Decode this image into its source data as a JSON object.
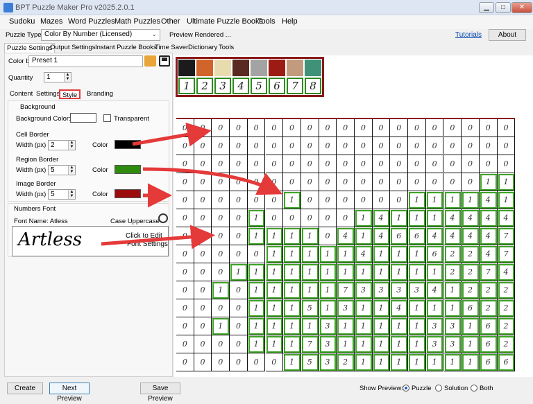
{
  "window": {
    "title": "BPT Puzzle Maker Pro v2025.2.0.1",
    "min": "▁",
    "max": "□",
    "close": "✕"
  },
  "menu": [
    "Sudoku",
    "Mazes",
    "Word Puzzles",
    "Math Puzzles",
    "Other",
    "Ultimate Puzzle Books",
    "Tools",
    "Help"
  ],
  "toolbar": {
    "puzzle_type_label": "Puzzle Type",
    "puzzle_type_value": "Color By Number (Licensed)",
    "status": "Preview Rendered ...",
    "tutorials": "Tutorials",
    "about": "About"
  },
  "tabs_main": [
    "Puzzle Settings",
    "Output Settings",
    "Instant Puzzle Books",
    "Time Saver",
    "Dictionary",
    "Tools"
  ],
  "color_by": {
    "label": "Color by",
    "value": "Preset 1"
  },
  "quantity": {
    "label": "Quantity",
    "value": "1"
  },
  "tabs_sub": [
    "Content",
    "Settings",
    "Style",
    "Branding"
  ],
  "background": {
    "title": "Background",
    "color_label": "Background Color:",
    "transparent_label": "Transparent"
  },
  "cell_border": {
    "title": "Cell Border",
    "width_label": "Width (px)",
    "width_value": "2",
    "color_label": "Color",
    "color": "#000000"
  },
  "region_border": {
    "title": "Region Border",
    "width_label": "Width (px)",
    "width_value": "5",
    "color_label": "Color",
    "color": "#2e8b0e"
  },
  "image_border": {
    "title": "Image Border",
    "width_label": "Width (px)",
    "width_value": "5",
    "color_label": "Color",
    "color": "#9b0d0d"
  },
  "numbers_font": {
    "title": "Numbers Font",
    "font_name": "Font Name: Atless",
    "case": "Case Uppercase",
    "sample": "Artless",
    "hint_line1": "Click to Edit",
    "hint_line2": "Font Settings"
  },
  "legend": {
    "colors": [
      "#1b1b1b",
      "#d0642a",
      "#e8dcae",
      "#5a2a22",
      "#a3a3a3",
      "#9c1b12",
      "#c29a7d",
      "#3f9178"
    ],
    "numbers": [
      "1",
      "2",
      "3",
      "4",
      "5",
      "6",
      "7",
      "8"
    ]
  },
  "puzzle_rows": [
    "0000000000000000000",
    "0000000000000000000",
    "0000000000000000000",
    "0000000000000000011",
    "0000001000000111141",
    "0000100000141114444",
    "0000111104146644447",
    "0000011111411162247",
    "0001111111111112274",
    "0010111117333341222",
    "0000111513114111622",
    "0010111131111133162",
    "0000111731111133162",
    "0000001532111111166"
  ],
  "status_bar": {
    "create": "Create",
    "next_preview": "Next Preview",
    "save_preview": "Save Preview",
    "show_preview_label": "Show Preview:",
    "opt_puzzle": "Puzzle",
    "opt_solution": "Solution",
    "opt_both": "Both"
  }
}
